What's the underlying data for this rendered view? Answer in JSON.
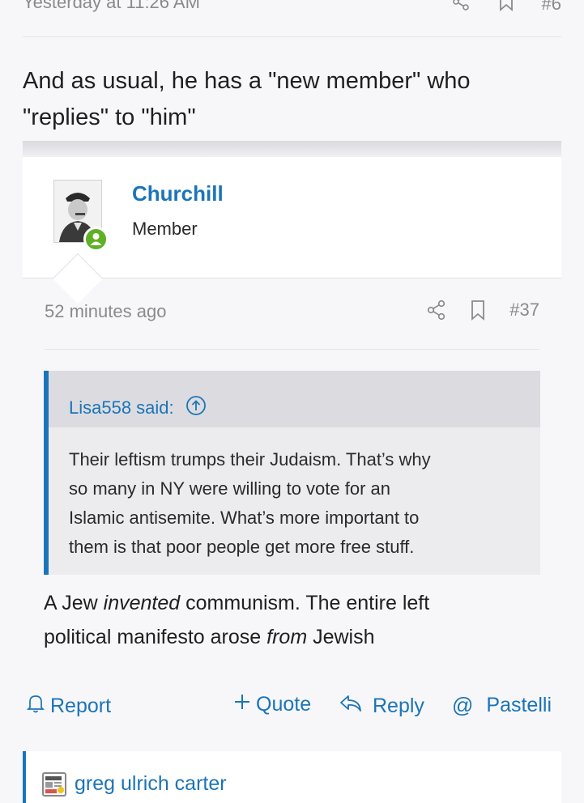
{
  "previous_post": {
    "timestamp": "Yesterday at 11:26 AM",
    "post_number": "#6",
    "body_text_line1": "And as usual, he has a \"new member\" who",
    "body_text_line2": "\"replies\" to \"him\""
  },
  "post": {
    "username": "Churchill",
    "user_title": "Member",
    "timestamp": "52 minutes ago",
    "post_number": "#37",
    "quote": {
      "author_label": "Lisa558 said:",
      "text_lines": [
        "Their leftism trumps their Judaism. That’s why",
        "so many in NY were willing to vote for an",
        "Islamic antisemite. What’s more important to",
        "them is that poor people get more free stuff."
      ]
    },
    "body": {
      "line1_pre": "A Jew ",
      "line1_em": "invented",
      "line1_post": " communism. The entire left",
      "line2_pre": "political manifesto arose ",
      "line2_em": "from",
      "line2_post": " Jewish"
    },
    "actions": {
      "report_label": "Report",
      "quote_label": "Quote",
      "reply_label": "Reply",
      "mention_label": "Pastelli"
    }
  },
  "next_post": {
    "username": "greg ulrich carter"
  },
  "colors": {
    "accent": "#1b74b8",
    "online": "#5fb023",
    "background": "#f7f7f9"
  },
  "icons": [
    "share-icon",
    "bookmark-icon",
    "bell-icon",
    "plus-icon",
    "reply-arrow-icon",
    "at-icon",
    "arrow-up-circle-icon",
    "news-icon"
  ]
}
